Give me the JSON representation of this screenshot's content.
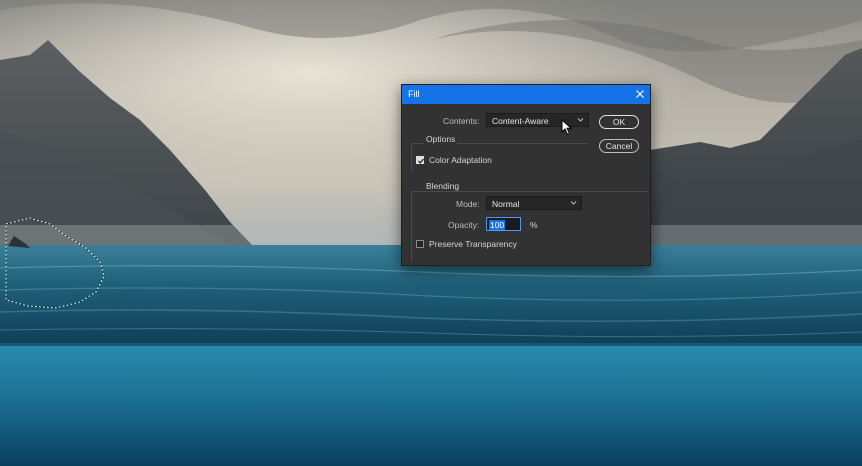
{
  "dialog": {
    "title": "Fill",
    "contents_label": "Contents:",
    "contents_value": "Content-Aware",
    "options_label": "Options",
    "color_adaptation_label": "Color Adaptation",
    "color_adaptation_checked": true,
    "blending_label": "Blending",
    "mode_label": "Mode:",
    "mode_value": "Normal",
    "opacity_label": "Opacity:",
    "opacity_value": "100",
    "opacity_unit": "%",
    "preserve_transparency_label": "Preserve Transparency",
    "preserve_transparency_checked": false,
    "ok_label": "OK",
    "cancel_label": "Cancel"
  },
  "colors": {
    "titlebar": "#1473e6",
    "dialog_bg": "#323232",
    "field_bg": "#262626"
  },
  "icons": {
    "close": "close-icon",
    "dropdown": "chevron-down-icon",
    "check": "checkmark-icon",
    "pointer": "mouse-pointer-icon"
  }
}
